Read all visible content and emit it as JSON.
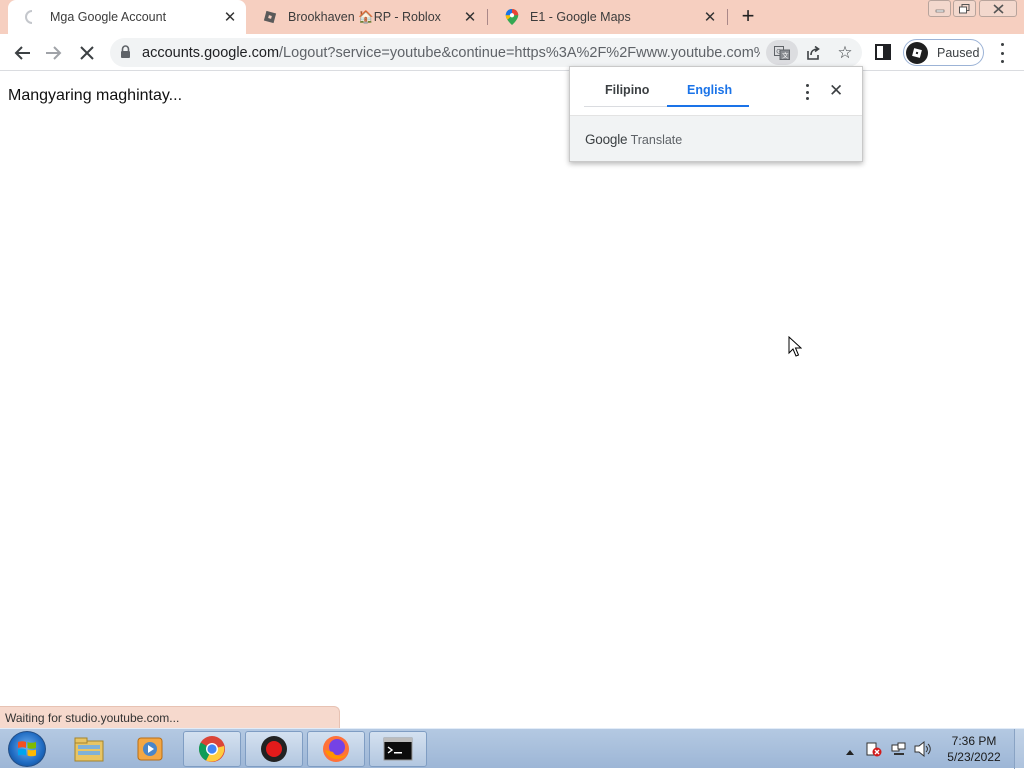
{
  "browser": {
    "tabs": [
      {
        "title": "Mga Google Account",
        "icon": "loading-spinner-icon",
        "active": true
      },
      {
        "title": "Brookhaven 🏠RP - Roblox",
        "icon": "roblox-icon",
        "active": false
      },
      {
        "title": "E1 - Google Maps",
        "icon": "google-maps-icon",
        "active": false
      }
    ],
    "new_tab_glyph": "+",
    "url_host": "accounts.google.com",
    "url_path": "/Logout?service=youtube&continue=https%3A%2F%2Fwww.youtube.com%2F",
    "profile_label": "Paused"
  },
  "page": {
    "message": "Mangyaring maghintay..."
  },
  "translate_popup": {
    "source_language": "Filipino",
    "target_language": "English",
    "selected": "English",
    "brand_google": "Google",
    "brand_translate": "Translate"
  },
  "status_bar": {
    "text": "Waiting for studio.youtube.com..."
  },
  "taskbar": {
    "apps": [
      "windows-explorer-icon",
      "media-player-icon",
      "chrome-icon",
      "recorder-icon",
      "firefox-icon",
      "cmd-icon"
    ],
    "time": "7:36 PM",
    "date": "5/23/2022"
  }
}
